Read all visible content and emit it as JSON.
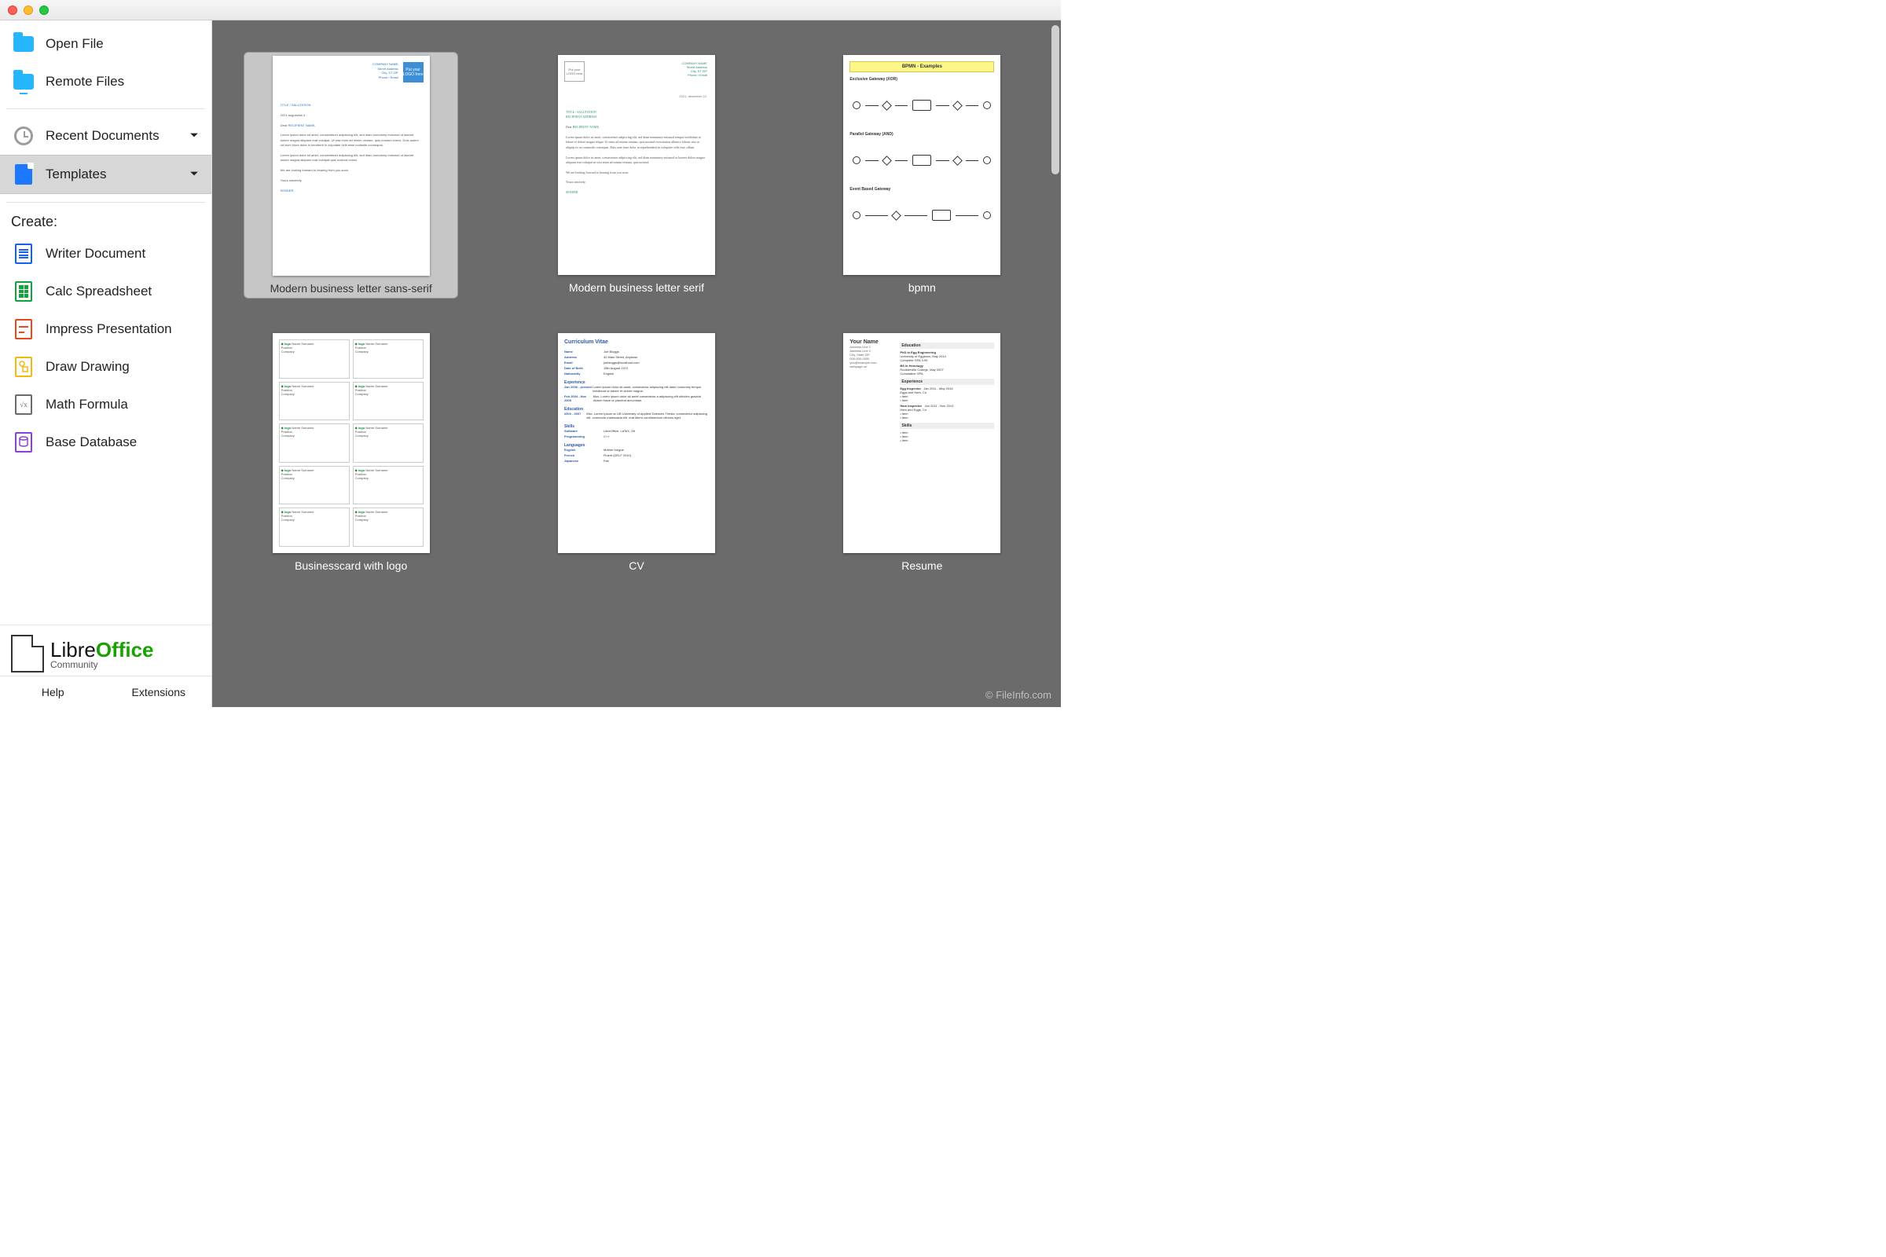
{
  "sidebar": {
    "open_file": "Open File",
    "remote_files": "Remote Files",
    "recent_documents": "Recent Documents",
    "templates": "Templates",
    "create_label": "Create:",
    "create_items": [
      {
        "label": "Writer Document"
      },
      {
        "label": "Calc Spreadsheet"
      },
      {
        "label": "Impress Presentation"
      },
      {
        "label": "Draw Drawing"
      },
      {
        "label": "Math Formula"
      },
      {
        "label": "Base Database"
      }
    ]
  },
  "branding": {
    "name_part1": "Libre",
    "name_part2": "Office",
    "subtitle": "Community"
  },
  "footer": {
    "help": "Help",
    "extensions": "Extensions"
  },
  "templates": [
    {
      "label": "Modern business letter sans-serif",
      "selected": true
    },
    {
      "label": "Modern business letter serif",
      "selected": false
    },
    {
      "label": "bpmn",
      "selected": false
    },
    {
      "label": "Businesscard with logo",
      "selected": false
    },
    {
      "label": "CV",
      "selected": false
    },
    {
      "label": "Resume",
      "selected": false
    }
  ],
  "watermark": "© FileInfo.com",
  "thumb_text": {
    "logo_placeholder": "Put your LOGO here",
    "bpmn_title": "BPMN - Examples",
    "bpmn_sections": [
      "Exclusive Gateway (XOR)",
      "Parallel Gateway (AND)",
      "Event Based Gateway"
    ],
    "biz_card_name": "Name Surname",
    "cv_title": "Curriculum Vitae",
    "resume_name": "Your Name"
  }
}
